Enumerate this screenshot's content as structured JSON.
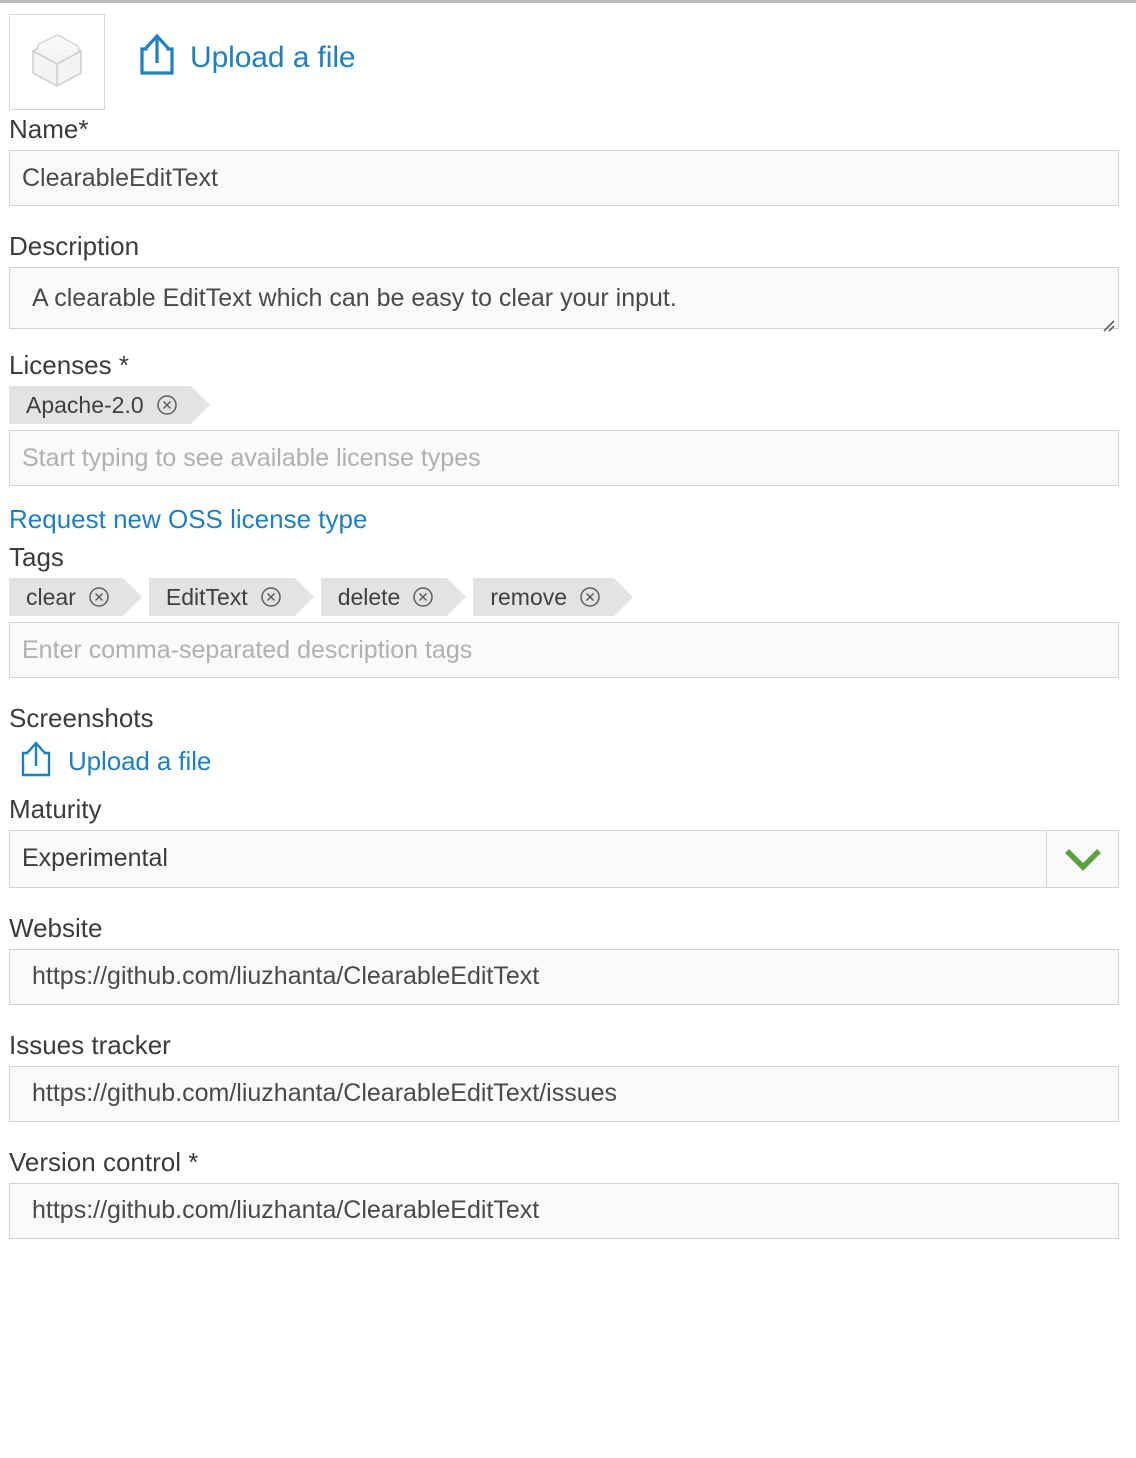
{
  "header": {
    "thumbnail_icon": "cube-placeholder-icon",
    "upload_icon": "upload-share-icon",
    "upload_label": "Upload a file"
  },
  "name_field": {
    "label": "Name*",
    "value": "ClearableEditText"
  },
  "description_field": {
    "label": "Description",
    "value": "A clearable EditText which can be easy to clear your input."
  },
  "licenses_field": {
    "label": "Licenses *",
    "chips": [
      {
        "label": "Apache-2.0",
        "remove_icon": "circle-x-icon"
      }
    ],
    "placeholder": "Start typing to see available license types",
    "value": "",
    "request_link": "Request new OSS license type"
  },
  "tags_field": {
    "label": "Tags",
    "chips": [
      {
        "label": "clear",
        "remove_icon": "circle-x-icon"
      },
      {
        "label": "EditText",
        "remove_icon": "circle-x-icon"
      },
      {
        "label": "delete",
        "remove_icon": "circle-x-icon"
      },
      {
        "label": "remove",
        "remove_icon": "circle-x-icon"
      }
    ],
    "placeholder": "Enter comma-separated description tags",
    "value": ""
  },
  "screenshots_field": {
    "label": "Screenshots",
    "upload_icon": "upload-share-icon",
    "upload_label": "Upload a file"
  },
  "maturity_field": {
    "label": "Maturity",
    "value": "Experimental",
    "arrow_icon": "chevron-down-icon"
  },
  "website_field": {
    "label": "Website",
    "value": "https://github.com/liuzhanta/ClearableEditText"
  },
  "issues_field": {
    "label": "Issues tracker",
    "value": "https://github.com/liuzhanta/ClearableEditText/issues"
  },
  "version_control_field": {
    "label": "Version control *",
    "value": "https://github.com/liuzhanta/ClearableEditText"
  },
  "colors": {
    "link": "#1f7fc1",
    "chip_bg": "#e3e3e3",
    "input_bg": "#fafafa",
    "input_border": "#d3d3d3",
    "chevron_green": "#5aa340",
    "top_rule": "#b9bdc1"
  }
}
